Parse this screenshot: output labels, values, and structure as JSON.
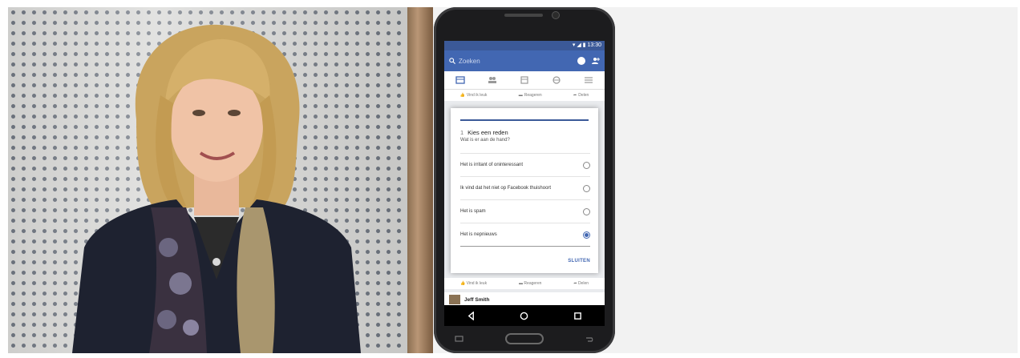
{
  "phone": {
    "status_time": "13:30",
    "search_placeholder": "Zoeken",
    "top_actions": {
      "like": "Vind ik leuk",
      "comment": "Reageren",
      "share": "Delen"
    },
    "dialog": {
      "step_number": "1",
      "title": "Kies een reden",
      "subtitle": "Wat is er aan de hand?",
      "options": [
        {
          "label": "Het is irritant of oninteressant",
          "selected": false
        },
        {
          "label": "Ik vind dat het niet op Facebook thuishoort",
          "selected": false
        },
        {
          "label": "Het is spam",
          "selected": false
        },
        {
          "label": "Het is nepnieuws",
          "selected": true
        }
      ],
      "close_label": "SLUITEN"
    },
    "bottom_actions": {
      "like": "Vind ik leuk",
      "comment": "Reageren",
      "share": "Delen"
    },
    "author_name": "Jeff Smith"
  },
  "colors": {
    "facebook_blue": "#4267b2",
    "status_blue": "#3b5998"
  }
}
